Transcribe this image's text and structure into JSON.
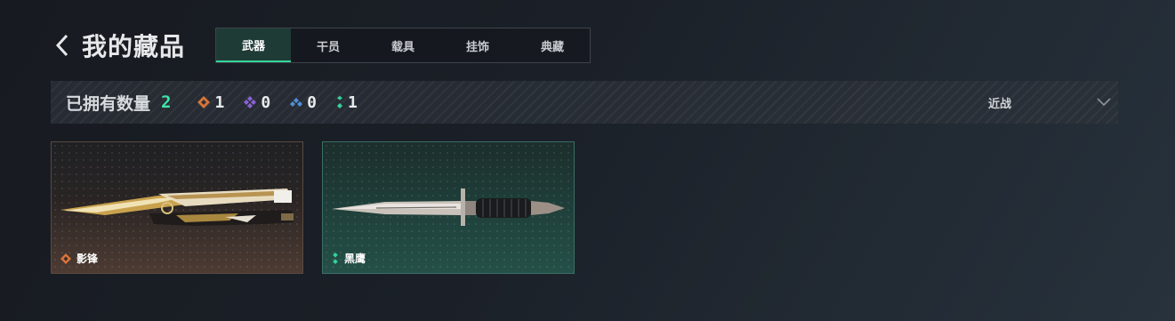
{
  "header": {
    "back_icon": "chevron-left-icon",
    "title": "我的藏品",
    "tabs": [
      {
        "label": "武器",
        "active": true
      },
      {
        "label": "干员",
        "active": false
      },
      {
        "label": "载具",
        "active": false
      },
      {
        "label": "挂饰",
        "active": false
      },
      {
        "label": "典藏",
        "active": false
      }
    ]
  },
  "summary": {
    "owned_label": "已拥有数量",
    "owned_count": "2",
    "rarities": [
      {
        "icon": "orange-rarity-icon",
        "color": "#d9753a",
        "count": "1"
      },
      {
        "icon": "purple-rarity-icon",
        "color": "#8a62d6",
        "count": "0"
      },
      {
        "icon": "blue-rarity-icon",
        "color": "#4f8fd6",
        "count": "0"
      },
      {
        "icon": "green-rarity-icon",
        "color": "#34d39a",
        "count": "1"
      }
    ],
    "filter": {
      "selected": "近战",
      "icon": "chevron-down-icon"
    }
  },
  "items": [
    {
      "name": "影锋",
      "rarity": "orange",
      "rarity_color": "#d9753a"
    },
    {
      "name": "黑鹰",
      "rarity": "green",
      "rarity_color": "#34d39a"
    }
  ],
  "colors": {
    "accent": "#34d39a",
    "background": "#1b2028"
  }
}
